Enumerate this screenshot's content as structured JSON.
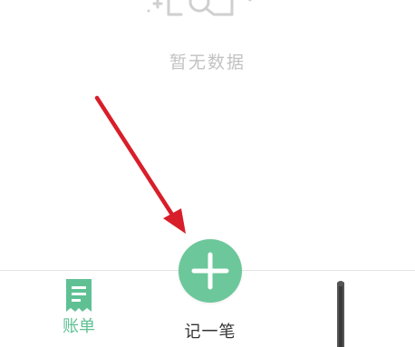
{
  "empty_state": {
    "icon": "empty-data-illustration",
    "message": "暂无数据"
  },
  "tab_bar": {
    "bills": {
      "label": "账单",
      "icon": "bill-icon",
      "active": true
    },
    "add_record": {
      "label": "记一笔",
      "icon": "plus-icon"
    },
    "right_tab": {
      "icon": "partial-tab-icon"
    }
  },
  "annotation": {
    "icon": "red-arrow-icon"
  },
  "colors": {
    "accent_green": "#6cc79a",
    "bill_green": "#5fc093",
    "empty_gray": "#c2c2c2",
    "arrow_red": "#d81e2a"
  }
}
